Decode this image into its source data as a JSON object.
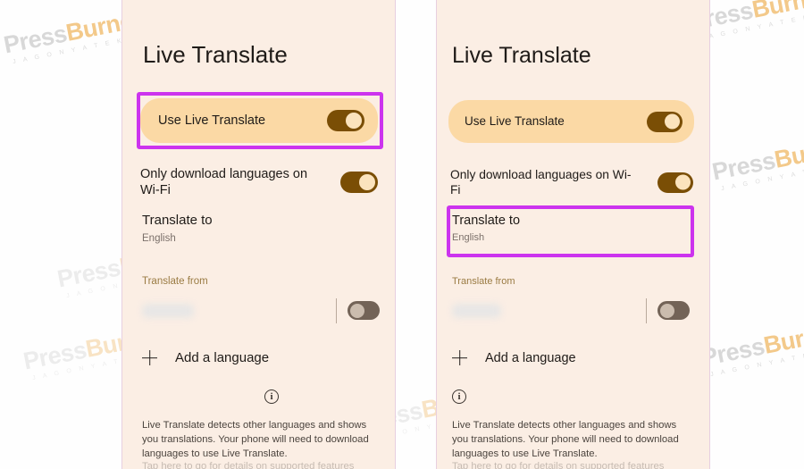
{
  "watermark": {
    "brand_first": "Press",
    "brand_second": "Burner",
    "tagline": "J A G O N Y A   T E K N O L O G I"
  },
  "screen": {
    "title": "Live Translate",
    "use_live_translate": {
      "label": "Use Live Translate",
      "toggle_state": "on"
    },
    "wifi_only": {
      "label": "Only download languages on Wi-Fi",
      "label_line1": "Only download languages on",
      "label_line2": "Wi-Fi",
      "toggle_state": "on"
    },
    "translate_to": {
      "label": "Translate to",
      "value": "English"
    },
    "translate_from": {
      "section_label": "Translate from",
      "language": "",
      "toggle_state": "off"
    },
    "add_language": {
      "label": "Add a language",
      "icon": "plus-icon"
    },
    "info": {
      "icon": "info-circle-icon",
      "paragraph": "Live Translate detects other languages and shows you translations. Your phone will need to download languages to use Live Translate.",
      "paragraph_clipped": "Tap here to go for details on supported features"
    }
  },
  "annotations": {
    "left_panel_target": "Use Live Translate",
    "right_panel_target": "Translate to",
    "highlight_color": "#cc33ee"
  },
  "colors": {
    "panel_background": "#fbeee4",
    "card_background": "#fbd9a5",
    "toggle_on_track": "#7a4e05",
    "toggle_on_knob": "#fbe3bd",
    "toggle_off_track": "#736357",
    "toggle_off_knob": "#cbbcae",
    "section_label": "#9a7b43",
    "panel_border": "#e7cfe0"
  }
}
